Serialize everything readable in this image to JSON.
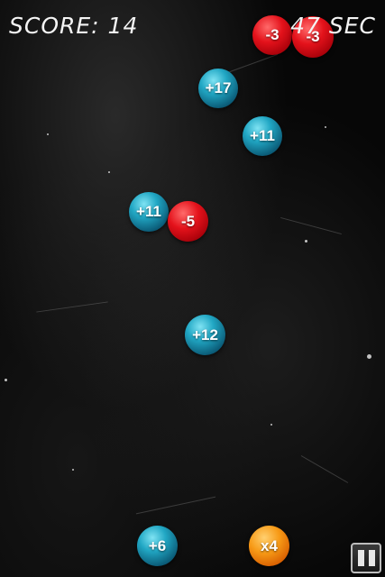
{
  "hud": {
    "score_text": "SCORE: 14",
    "timer_text": "47 SEC"
  },
  "balls": [
    {
      "label": "-3",
      "color": "red"
    },
    {
      "label": "-3",
      "color": "red"
    },
    {
      "label": "+17",
      "color": "blue"
    },
    {
      "label": "+11",
      "color": "blue"
    },
    {
      "label": "+11",
      "color": "blue"
    },
    {
      "label": "-5",
      "color": "red"
    },
    {
      "label": "+12",
      "color": "blue"
    },
    {
      "label": "+6",
      "color": "blue"
    },
    {
      "label": "x4",
      "color": "orange"
    }
  ],
  "controls": {
    "pause_icon": "pause-icon"
  }
}
